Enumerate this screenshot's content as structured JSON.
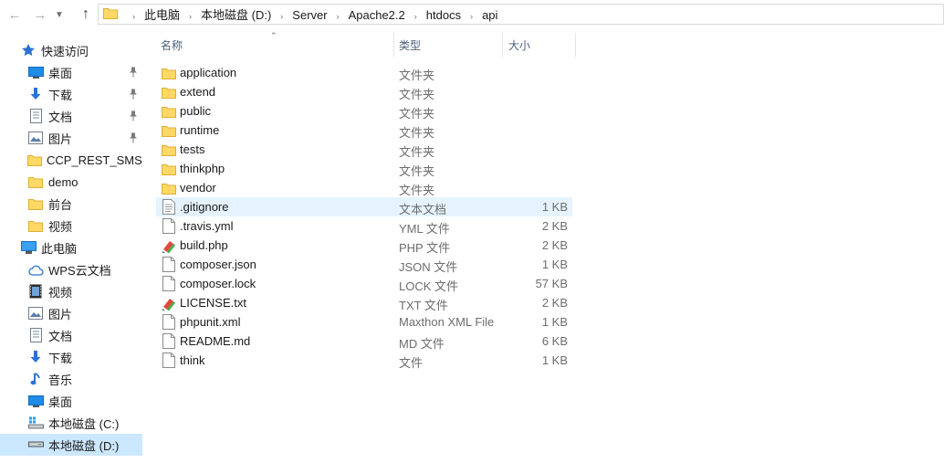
{
  "breadcrumb": [
    "此电脑",
    "本地磁盘 (D:)",
    "Server",
    "Apache2.2",
    "htdocs",
    "api"
  ],
  "columns": {
    "name": "名称",
    "type": "类型",
    "size": "大小"
  },
  "sidebar": [
    {
      "label": "快速访问",
      "icon": "star-icon",
      "indent": 0,
      "pinned": false
    },
    {
      "label": "桌面",
      "icon": "desktop-icon",
      "indent": 1,
      "pinned": true
    },
    {
      "label": "下载",
      "icon": "download-arrow-icon",
      "indent": 1,
      "pinned": true
    },
    {
      "label": "文档",
      "icon": "document-icon",
      "indent": 1,
      "pinned": true
    },
    {
      "label": "图片",
      "icon": "picture-icon",
      "indent": 1,
      "pinned": true
    },
    {
      "label": "CCP_REST_SMS_D",
      "icon": "folder-icon",
      "indent": 1,
      "pinned": false
    },
    {
      "label": "demo",
      "icon": "folder-icon",
      "indent": 1,
      "pinned": false
    },
    {
      "label": "前台",
      "icon": "folder-icon",
      "indent": 1,
      "pinned": false
    },
    {
      "label": "视频",
      "icon": "folder-icon",
      "indent": 1,
      "pinned": false
    },
    {
      "label": "此电脑",
      "icon": "computer-icon",
      "indent": 0,
      "pinned": false
    },
    {
      "label": "WPS云文档",
      "icon": "cloud-icon",
      "indent": 1,
      "pinned": false
    },
    {
      "label": "视频",
      "icon": "video-icon",
      "indent": 1,
      "pinned": false
    },
    {
      "label": "图片",
      "icon": "picture-icon",
      "indent": 1,
      "pinned": false
    },
    {
      "label": "文档",
      "icon": "document-icon",
      "indent": 1,
      "pinned": false
    },
    {
      "label": "下载",
      "icon": "download-arrow-icon",
      "indent": 1,
      "pinned": false
    },
    {
      "label": "音乐",
      "icon": "music-note-icon",
      "indent": 1,
      "pinned": false
    },
    {
      "label": "桌面",
      "icon": "desktop-icon",
      "indent": 1,
      "pinned": false
    },
    {
      "label": "本地磁盘 (C:)",
      "icon": "windows-drive-icon",
      "indent": 1,
      "pinned": false
    },
    {
      "label": "本地磁盘 (D:)",
      "icon": "drive-icon",
      "indent": 1,
      "pinned": false,
      "selected": true
    }
  ],
  "files": [
    {
      "name": "application",
      "type": "文件夹",
      "size": "",
      "icon": "folder-icon"
    },
    {
      "name": "extend",
      "type": "文件夹",
      "size": "",
      "icon": "folder-icon"
    },
    {
      "name": "public",
      "type": "文件夹",
      "size": "",
      "icon": "folder-icon"
    },
    {
      "name": "runtime",
      "type": "文件夹",
      "size": "",
      "icon": "folder-icon"
    },
    {
      "name": "tests",
      "type": "文件夹",
      "size": "",
      "icon": "folder-icon"
    },
    {
      "name": "thinkphp",
      "type": "文件夹",
      "size": "",
      "icon": "folder-icon"
    },
    {
      "name": "vendor",
      "type": "文件夹",
      "size": "",
      "icon": "folder-icon"
    },
    {
      "name": ".gitignore",
      "type": "文本文档",
      "size": "1 KB",
      "icon": "text-file-icon",
      "hover": true
    },
    {
      "name": ".travis.yml",
      "type": "YML 文件",
      "size": "2 KB",
      "icon": "blank-file-icon"
    },
    {
      "name": "build.php",
      "type": "PHP 文件",
      "size": "2 KB",
      "icon": "editor-file-icon"
    },
    {
      "name": "composer.json",
      "type": "JSON 文件",
      "size": "1 KB",
      "icon": "blank-file-icon"
    },
    {
      "name": "composer.lock",
      "type": "LOCK 文件",
      "size": "57 KB",
      "icon": "blank-file-icon"
    },
    {
      "name": "LICENSE.txt",
      "type": "TXT 文件",
      "size": "2 KB",
      "icon": "editor-file-icon"
    },
    {
      "name": "phpunit.xml",
      "type": "Maxthon XML File",
      "size": "1 KB",
      "icon": "blank-file-icon"
    },
    {
      "name": "README.md",
      "type": "MD 文件",
      "size": "6 KB",
      "icon": "blank-file-icon"
    },
    {
      "name": "think",
      "type": "文件",
      "size": "1 KB",
      "icon": "blank-file-icon"
    }
  ],
  "colors": {
    "folder": "#ffd866",
    "folder_dark": "#e8b634",
    "selected": "#cce8ff",
    "hover": "#e5f3ff",
    "accent": "#2b73d2"
  }
}
